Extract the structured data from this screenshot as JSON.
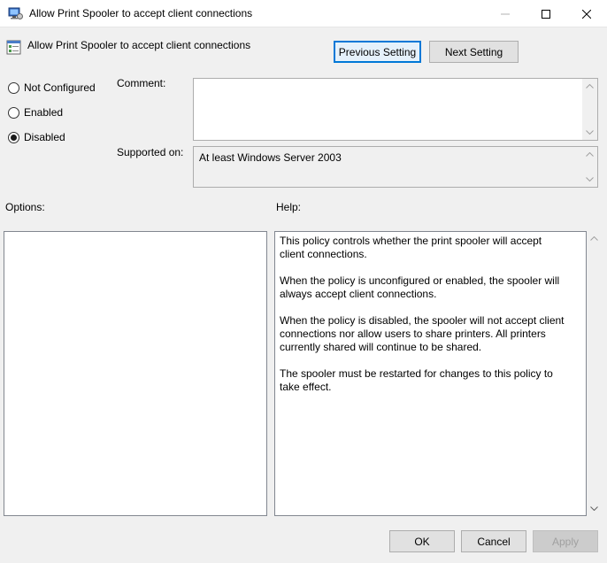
{
  "window": {
    "title": "Allow Print Spooler to accept client connections"
  },
  "header": {
    "setting_title": "Allow Print Spooler to accept client connections",
    "previous_label": "Previous Setting",
    "next_label": "Next Setting"
  },
  "state": {
    "options": [
      {
        "label": "Not Configured",
        "selected": false
      },
      {
        "label": "Enabled",
        "selected": false
      },
      {
        "label": "Disabled",
        "selected": true
      }
    ]
  },
  "comment": {
    "label": "Comment:",
    "value": ""
  },
  "supported": {
    "label": "Supported on:",
    "value": "At least Windows Server 2003"
  },
  "options_panel": {
    "label": "Options:"
  },
  "help": {
    "label": "Help:",
    "paragraphs": [
      "This policy controls whether the print spooler will accept client connections.",
      "When the policy is unconfigured or enabled, the spooler will always accept client connections.",
      "When the policy is disabled, the spooler will not accept client connections nor allow users to share printers.  All printers currently shared will continue to be shared.",
      "The spooler must be restarted for changes to this policy to take effect."
    ]
  },
  "footer": {
    "ok_label": "OK",
    "cancel_label": "Cancel",
    "apply_label": "Apply"
  },
  "colors": {
    "focus_border": "#0078d7",
    "window_bg": "#f0f0f0"
  }
}
